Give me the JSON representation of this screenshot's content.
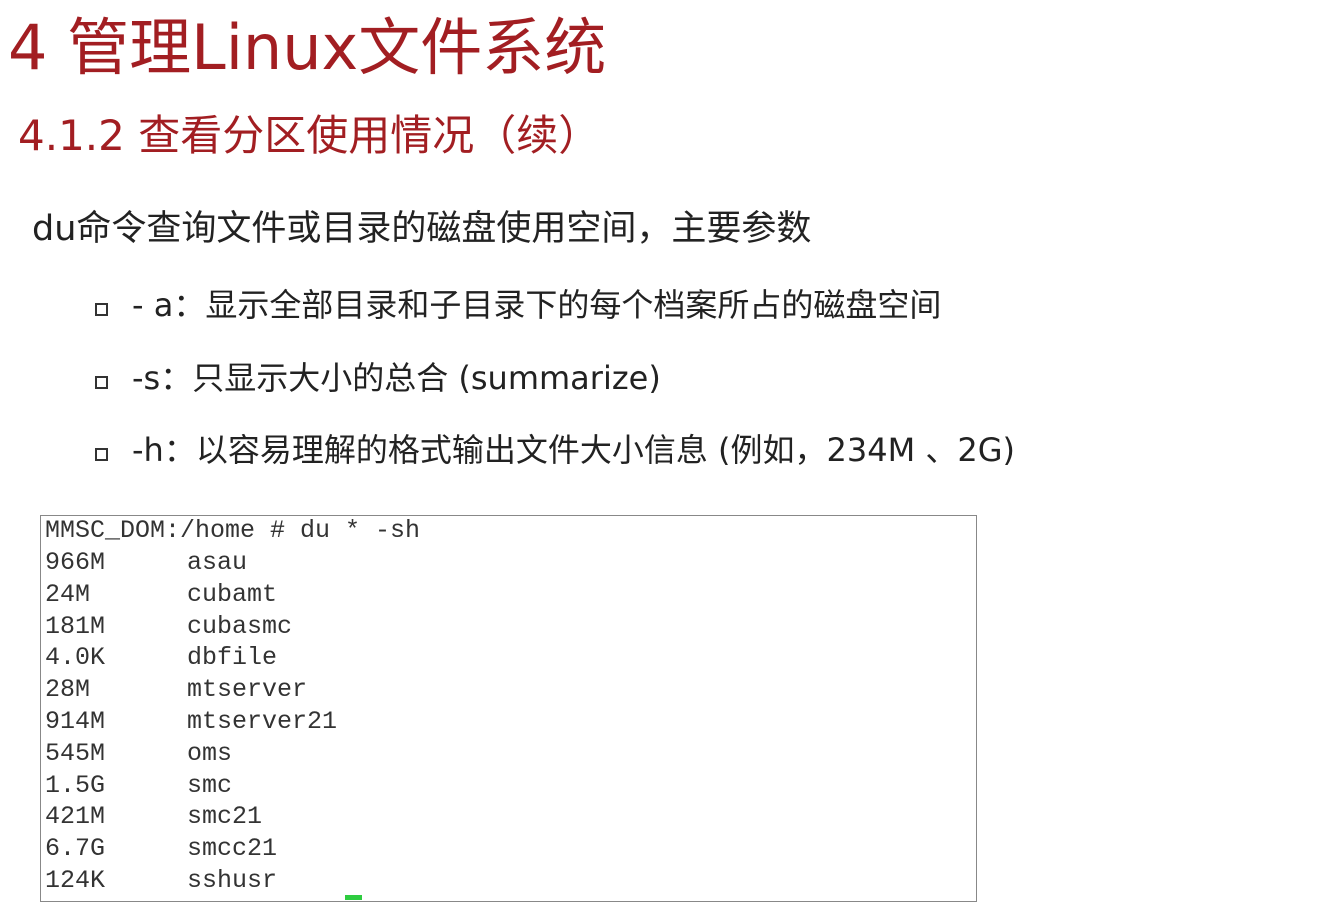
{
  "slide": {
    "title": "4  管理Linux文件系统",
    "subtitle": "4.1.2 查看分区使用情况（续）",
    "intro": "du命令查询文件或目录的磁盘使用空间，主要参数",
    "bullets": [
      {
        "text": "- a：显示全部目录和子目录下的每个档案所占的磁盘空间"
      },
      {
        "text": "-s：只显示大小的总合 (summarize)"
      },
      {
        "text": "-h：以容易理解的格式输出文件大小信息 (例如，234M 、2G)"
      }
    ],
    "accent_color": "#A21E22"
  },
  "terminal": {
    "command": "MMSC_DOM:/home # du * -sh",
    "rows": [
      {
        "size": "966M",
        "name": "asau"
      },
      {
        "size": "24M",
        "name": "cubamt"
      },
      {
        "size": "181M",
        "name": "cubasmc"
      },
      {
        "size": "4.0K",
        "name": "dbfile"
      },
      {
        "size": "28M",
        "name": "mtserver"
      },
      {
        "size": "914M",
        "name": "mtserver21"
      },
      {
        "size": "545M",
        "name": "oms"
      },
      {
        "size": "1.5G",
        "name": "smc"
      },
      {
        "size": "421M",
        "name": "smc21"
      },
      {
        "size": "6.7G",
        "name": "smcc21"
      },
      {
        "size": "124K",
        "name": "sshusr"
      }
    ]
  }
}
